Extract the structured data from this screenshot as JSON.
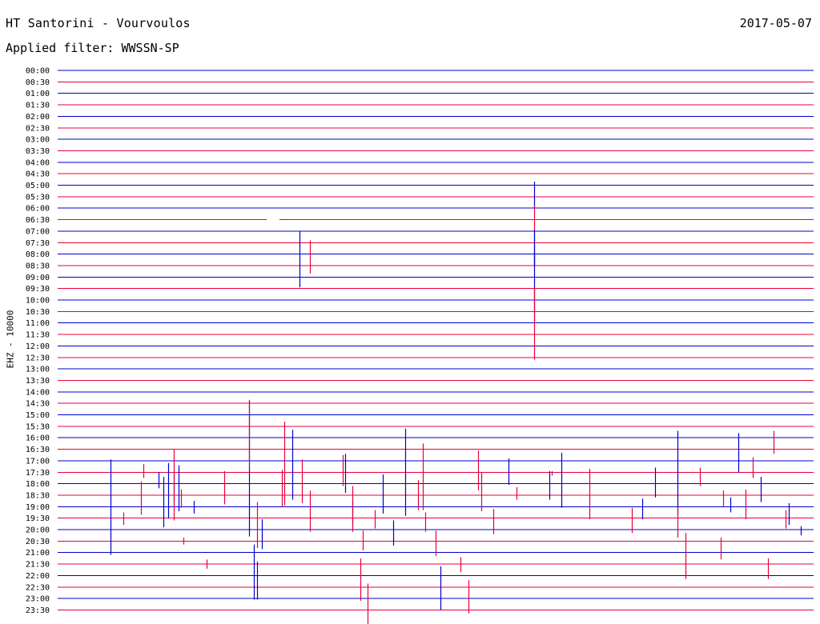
{
  "header": {
    "station": "HT Santorini - Vourvoulos",
    "date": "2017-05-07",
    "filter": "Applied filter: WWSSN-SP"
  },
  "channel_label": "EHZ - 10000",
  "colors": {
    "odd_line": "#0000cc",
    "even_line": "#e8003c",
    "background": "#ffffff"
  },
  "chart_data": {
    "type": "line",
    "title": "HT Santorini - Vourvoulos",
    "ylabel": "EHZ - 10000",
    "grid": false,
    "row_ticks": [
      "00:00",
      "00:30",
      "01:00",
      "01:30",
      "02:00",
      "02:30",
      "03:00",
      "03:30",
      "04:00",
      "04:30",
      "05:00",
      "05:30",
      "06:00",
      "06:30",
      "07:00",
      "07:30",
      "08:00",
      "08:30",
      "09:00",
      "09:30",
      "10:00",
      "10:30",
      "11:00",
      "11:30",
      "12:00",
      "12:30",
      "13:00",
      "13:30",
      "14:00",
      "14:30",
      "15:00",
      "15:30",
      "16:00",
      "16:30",
      "17:00",
      "17:30",
      "18:00",
      "18:30",
      "19:00",
      "19:30",
      "20:00",
      "20:30",
      "21:00",
      "21:30",
      "22:00",
      "22:30",
      "23:00",
      "23:30"
    ],
    "x_minutes_per_row": 30,
    "data_gap": {
      "row": "06:30",
      "start_min": 8.3,
      "end_min": 8.8
    },
    "events": [
      {
        "row": "07:00",
        "minute": 9.6,
        "up": 0,
        "down": 4.9
      },
      {
        "row": "07:30",
        "minute": 10.0,
        "up": 0.2,
        "down": 2.7
      },
      {
        "row": "06:00",
        "minute": 18.9,
        "up": 2.3,
        "down": 0
      },
      {
        "row": "06:30",
        "minute": 18.9,
        "up": 1.2,
        "down": 4.0
      },
      {
        "row": "07:00",
        "minute": 18.9,
        "up": 0.1,
        "down": 3.0
      },
      {
        "row": "08:00",
        "minute": 18.9,
        "up": 0.1,
        "down": 5.9
      },
      {
        "row": "09:30",
        "minute": 18.9,
        "up": 0.1,
        "down": 6.2
      },
      {
        "row": "17:00",
        "minute": 2.1,
        "up": 0.1,
        "down": 8.2
      },
      {
        "row": "17:30",
        "minute": 3.4,
        "up": 0.7,
        "down": 0.5
      },
      {
        "row": "18:30",
        "minute": 3.3,
        "up": 1.2,
        "down": 1.7
      },
      {
        "row": "19:30",
        "minute": 2.6,
        "up": 0.5,
        "down": 0.6
      },
      {
        "row": "20:30",
        "minute": 5.0,
        "up": 0.3,
        "down": 0.3
      },
      {
        "row": "18:00",
        "minute": 4.2,
        "up": 0.6,
        "down": 3.8
      },
      {
        "row": "18:00",
        "minute": 4.4,
        "up": 1.8,
        "down": 3.0
      },
      {
        "row": "18:00",
        "minute": 4.6,
        "up": 1.0,
        "down": 1.6
      },
      {
        "row": "18:00",
        "minute": 4.8,
        "up": 1.6,
        "down": 2.4
      },
      {
        "row": "17:30",
        "minute": 4.6,
        "up": 2.0,
        "down": 4.2
      },
      {
        "row": "18:00",
        "minute": 4.0,
        "up": 1.0,
        "down": 0.4
      },
      {
        "row": "18:30",
        "minute": 4.9,
        "up": 0.5,
        "down": 1.1
      },
      {
        "row": "19:00",
        "minute": 5.4,
        "up": 0.5,
        "down": 0.6
      },
      {
        "row": "17:30",
        "minute": 6.6,
        "up": 0.1,
        "down": 2.8
      },
      {
        "row": "21:30",
        "minute": 5.9,
        "up": 0.4,
        "down": 0.4
      },
      {
        "row": "17:30",
        "minute": 8.9,
        "up": 0.2,
        "down": 3.0
      },
      {
        "row": "15:00",
        "minute": 7.6,
        "up": 1.2,
        "down": 10.6
      },
      {
        "row": "14:30",
        "minute": 7.6,
        "up": 0.3,
        "down": 5.8
      },
      {
        "row": "19:30",
        "minute": 7.9,
        "up": 1.4,
        "down": 2.6
      },
      {
        "row": "20:00",
        "minute": 8.1,
        "up": 0.9,
        "down": 1.7
      },
      {
        "row": "21:00",
        "minute": 7.8,
        "up": 0.7,
        "down": 4.1
      },
      {
        "row": "22:00",
        "minute": 7.9,
        "up": 1.2,
        "down": 2.1
      },
      {
        "row": "15:30",
        "minute": 9.0,
        "up": 0.4,
        "down": 6.9
      },
      {
        "row": "16:00",
        "minute": 9.3,
        "up": 0.7,
        "down": 5.4
      },
      {
        "row": "17:30",
        "minute": 9.7,
        "up": 1.1,
        "down": 2.7
      },
      {
        "row": "18:30",
        "minute": 10.0,
        "up": 0.4,
        "down": 3.2
      },
      {
        "row": "17:00",
        "minute": 11.4,
        "up": 0.6,
        "down": 2.8
      },
      {
        "row": "17:30",
        "minute": 11.3,
        "up": 1.5,
        "down": 1.2
      },
      {
        "row": "19:00",
        "minute": 11.7,
        "up": 0.5,
        "down": 1.6
      },
      {
        "row": "18:30",
        "minute": 11.7,
        "up": 0.8,
        "down": 3.2
      },
      {
        "row": "20:30",
        "minute": 12.1,
        "up": 0.9,
        "down": 0.8
      },
      {
        "row": "21:30",
        "minute": 12.0,
        "up": 0.5,
        "down": 3.2
      },
      {
        "row": "22:30",
        "minute": 12.3,
        "up": 0.3,
        "down": 3.3
      },
      {
        "row": "18:00",
        "minute": 12.9,
        "up": 0.8,
        "down": 2.6
      },
      {
        "row": "19:30",
        "minute": 12.6,
        "up": 0.7,
        "down": 0.9
      },
      {
        "row": "20:00",
        "minute": 13.3,
        "up": 0.8,
        "down": 1.4
      },
      {
        "row": "16:00",
        "minute": 13.8,
        "up": 0.8,
        "down": 6.8
      },
      {
        "row": "16:30",
        "minute": 14.5,
        "up": 0.5,
        "down": 5.3
      },
      {
        "row": "18:30",
        "minute": 14.3,
        "up": 1.3,
        "down": 1.3
      },
      {
        "row": "19:30",
        "minute": 14.6,
        "up": 0.5,
        "down": 1.2
      },
      {
        "row": "20:30",
        "minute": 15.0,
        "up": 0.9,
        "down": 1.3
      },
      {
        "row": "22:00",
        "minute": 15.2,
        "up": 0.8,
        "down": 3.0
      },
      {
        "row": "21:30",
        "minute": 16.0,
        "up": 0.6,
        "down": 0.7
      },
      {
        "row": "22:30",
        "minute": 16.3,
        "up": 0.6,
        "down": 2.3
      },
      {
        "row": "17:30",
        "minute": 16.7,
        "up": 1.9,
        "down": 1.6
      },
      {
        "row": "18:30",
        "minute": 16.8,
        "up": 2.0,
        "down": 1.4
      },
      {
        "row": "19:30",
        "minute": 17.3,
        "up": 0.8,
        "down": 1.4
      },
      {
        "row": "17:00",
        "minute": 17.9,
        "up": 0.2,
        "down": 2.1
      },
      {
        "row": "18:30",
        "minute": 18.2,
        "up": 0.7,
        "down": 0.4
      },
      {
        "row": "18:00",
        "minute": 19.5,
        "up": 1.1,
        "down": 1.4
      },
      {
        "row": "17:30",
        "minute": 19.6,
        "up": 0.1,
        "down": 0.3
      },
      {
        "row": "17:00",
        "minute": 20.0,
        "up": 0.7,
        "down": 4.1
      },
      {
        "row": "17:30",
        "minute": 21.1,
        "up": 0.3,
        "down": 4.1
      },
      {
        "row": "19:30",
        "minute": 22.8,
        "up": 0.9,
        "down": 1.3
      },
      {
        "row": "19:00",
        "minute": 23.2,
        "up": 0.7,
        "down": 1.1
      },
      {
        "row": "18:00",
        "minute": 23.7,
        "up": 1.4,
        "down": 1.2
      },
      {
        "row": "17:00",
        "minute": 24.6,
        "up": 2.6,
        "down": 4.7
      },
      {
        "row": "19:30",
        "minute": 24.6,
        "up": 1.0,
        "down": 1.7
      },
      {
        "row": "20:30",
        "minute": 24.9,
        "up": 0.7,
        "down": 3.3
      },
      {
        "row": "17:30",
        "minute": 25.5,
        "up": 0.4,
        "down": 1.2
      },
      {
        "row": "19:00",
        "minute": 26.7,
        "up": 0.8,
        "down": 0.5
      },
      {
        "row": "18:30",
        "minute": 26.4,
        "up": 0.4,
        "down": 1.0
      },
      {
        "row": "18:30",
        "minute": 27.3,
        "up": 0.5,
        "down": 2.1
      },
      {
        "row": "16:00",
        "minute": 27.0,
        "up": 0.4,
        "down": 3.0
      },
      {
        "row": "16:30",
        "minute": 28.4,
        "up": 1.6,
        "down": 0.4
      },
      {
        "row": "21:30",
        "minute": 28.2,
        "up": 0.5,
        "down": 1.3
      },
      {
        "row": "19:00",
        "minute": 29.0,
        "up": 0.3,
        "down": 1.6
      },
      {
        "row": "19:30",
        "minute": 28.9,
        "up": 0.7,
        "down": 0.9
      },
      {
        "row": "20:00",
        "minute": 29.5,
        "up": 0.3,
        "down": 0.5
      },
      {
        "row": "20:30",
        "minute": 26.3,
        "up": 0.3,
        "down": 1.6
      },
      {
        "row": "18:00",
        "minute": 27.9,
        "up": 0.6,
        "down": 1.6
      },
      {
        "row": "17:30",
        "minute": 27.6,
        "up": 1.3,
        "down": 0.5
      }
    ]
  }
}
